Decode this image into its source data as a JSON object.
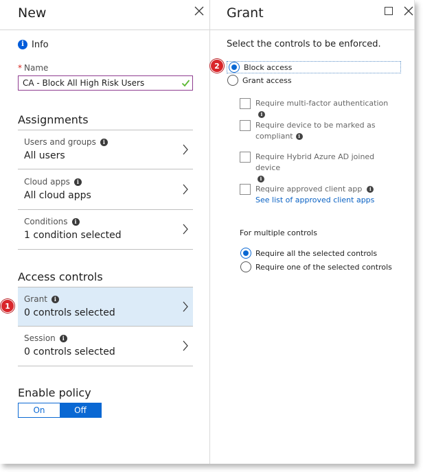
{
  "left_blade": {
    "title": "New",
    "info_label": "Info",
    "name": {
      "label": "Name",
      "value": "CA - Block All High Risk Users"
    },
    "assignments": {
      "heading": "Assignments",
      "items": [
        {
          "label": "Users and groups",
          "value": "All users"
        },
        {
          "label": "Cloud apps",
          "value": "All cloud apps"
        },
        {
          "label": "Conditions",
          "value": "1 condition selected"
        }
      ]
    },
    "access_controls": {
      "heading": "Access controls",
      "items": [
        {
          "label": "Grant",
          "value": "0 controls selected",
          "selected": true
        },
        {
          "label": "Session",
          "value": "0 controls selected"
        }
      ]
    },
    "enable_policy": {
      "heading": "Enable policy",
      "on_label": "On",
      "off_label": "Off",
      "selected": "Off"
    }
  },
  "right_blade": {
    "title": "Grant",
    "lead": "Select the controls to be enforced.",
    "access_options": [
      {
        "label": "Block access",
        "selected": true
      },
      {
        "label": "Grant access",
        "selected": false
      }
    ],
    "controls": [
      {
        "label": "Require multi-factor authentication",
        "checked": false
      },
      {
        "label": "Require device to be marked as compliant",
        "checked": false
      },
      {
        "label": "Require Hybrid Azure AD joined device",
        "checked": false
      },
      {
        "label": "Require approved client app",
        "checked": false,
        "link": "See list of approved client apps"
      }
    ],
    "multiple_controls": {
      "heading": "For multiple controls",
      "options": [
        {
          "label": "Require all the selected controls",
          "selected": true
        },
        {
          "label": "Require one of the selected controls",
          "selected": false
        }
      ]
    }
  },
  "callouts": [
    "1",
    "2"
  ],
  "colors": {
    "accent": "#0a68d3",
    "selected_row": "#dcebf8",
    "callout": "#d9262b",
    "input_border": "#8e3c8f",
    "valid_check": "#5bb832"
  }
}
